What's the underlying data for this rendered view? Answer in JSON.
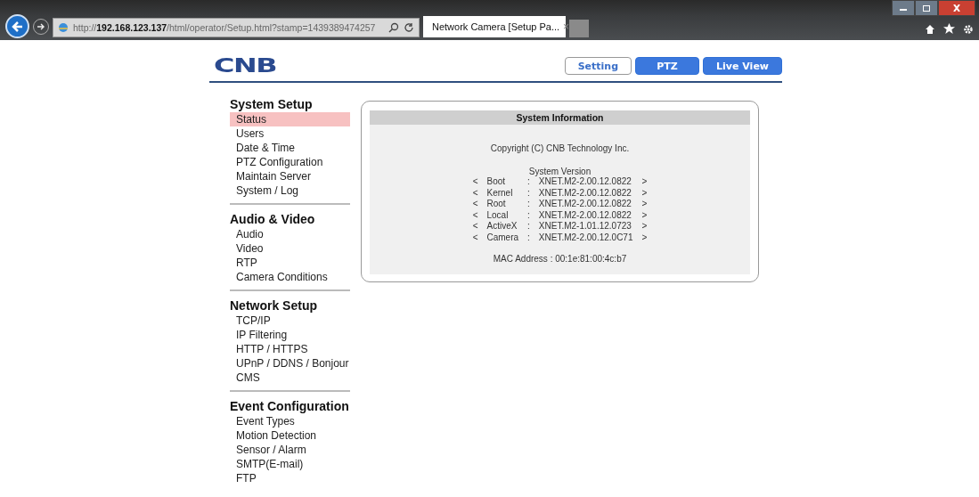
{
  "browser": {
    "address": "http://**192.168.123.137**/html/operator/Setup.html?stamp=1439389474257",
    "tab_title": "Network Camera [Setup Pa...",
    "tab_close": "×"
  },
  "header": {
    "logo": "CNB",
    "nav": [
      {
        "label": "Setting",
        "selected": true
      },
      {
        "label": "PTZ",
        "selected": false
      },
      {
        "label": "Live View",
        "selected": false
      }
    ]
  },
  "sidebar": [
    {
      "title": "System Setup",
      "items": [
        {
          "label": "Status",
          "selected": true
        },
        {
          "label": "Users",
          "selected": false
        },
        {
          "label": "Date & Time",
          "selected": false
        },
        {
          "label": "PTZ Configuration",
          "selected": false
        },
        {
          "label": "Maintain Server",
          "selected": false
        },
        {
          "label": "System / Log",
          "selected": false
        }
      ]
    },
    {
      "title": "Audio & Video",
      "items": [
        {
          "label": "Audio",
          "selected": false
        },
        {
          "label": "Video",
          "selected": false
        },
        {
          "label": "RTP",
          "selected": false
        },
        {
          "label": "Camera Conditions",
          "selected": false
        }
      ]
    },
    {
      "title": "Network Setup",
      "items": [
        {
          "label": "TCP/IP",
          "selected": false
        },
        {
          "label": "IP Filtering",
          "selected": false
        },
        {
          "label": "HTTP / HTTPS",
          "selected": false
        },
        {
          "label": "UPnP / DDNS / Bonjour",
          "selected": false
        },
        {
          "label": "CMS",
          "selected": false
        }
      ]
    },
    {
      "title": "Event Configuration",
      "items": [
        {
          "label": "Event Types",
          "selected": false
        },
        {
          "label": "Motion Detection",
          "selected": false
        },
        {
          "label": "Sensor / Alarm",
          "selected": false
        },
        {
          "label": "SMTP(E-mail)",
          "selected": false
        },
        {
          "label": "FTP",
          "selected": false
        }
      ]
    }
  ],
  "panel": {
    "title": "System Information",
    "copyright": "Copyright (C) CNB Technology Inc.",
    "version_title": "System Version",
    "versions": [
      {
        "open": "<",
        "name": "Boot",
        "sep": ":",
        "value": "XNET.M2-2.00.12.0822",
        "close": ">"
      },
      {
        "open": "<",
        "name": "Kernel",
        "sep": ":",
        "value": "XNET.M2-2.00.12.0822",
        "close": ">"
      },
      {
        "open": "<",
        "name": "Root",
        "sep": ":",
        "value": "XNET.M2-2.00.12.0822",
        "close": ">"
      },
      {
        "open": "<",
        "name": "Local",
        "sep": ":",
        "value": "XNET.M2-2.00.12.0822",
        "close": ">"
      },
      {
        "open": "<",
        "name": "ActiveX",
        "sep": ":",
        "value": "XNET.M2-1.01.12.0723",
        "close": ">"
      },
      {
        "open": "<",
        "name": "Camera",
        "sep": ":",
        "value": "XNET.M2-2.00.12.0C71",
        "close": ">"
      }
    ],
    "mac": "MAC Address : 00:1e:81:00:4c:b7"
  }
}
